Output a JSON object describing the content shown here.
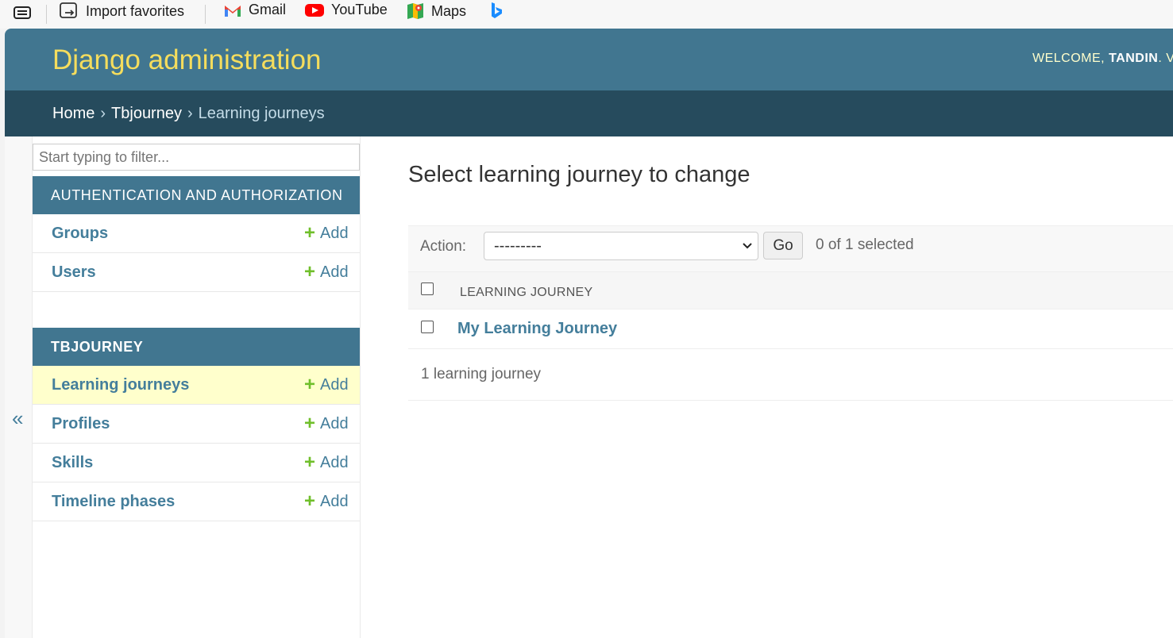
{
  "favorites_bar": {
    "items": [
      {
        "label": "",
        "icon": "tab-actions-icon"
      },
      {
        "label": "Import favorites",
        "icon": "import-favorites-icon"
      },
      {
        "label": "Gmail",
        "icon": "gmail-icon"
      },
      {
        "label": "YouTube",
        "icon": "youtube-icon"
      },
      {
        "label": "Maps",
        "icon": "maps-icon"
      },
      {
        "label": "",
        "icon": "bing-icon"
      }
    ]
  },
  "header": {
    "brand": "Django administration",
    "welcome": "WELCOME,",
    "username": "TANDIN",
    "after_user": ".",
    "view_site_partial": "VI"
  },
  "breadcrumbs": {
    "home": "Home",
    "app": "Tbjourney",
    "current": "Learning journeys",
    "separator": "›"
  },
  "sidebar": {
    "filter_placeholder": "Start typing to filter...",
    "collapse_label": "«",
    "add_label": "Add",
    "modules": [
      {
        "caption": "AUTHENTICATION AND AUTHORIZATION",
        "models": [
          {
            "name": "Groups"
          },
          {
            "name": "Users"
          }
        ]
      },
      {
        "caption": "TBJOURNEY",
        "models": [
          {
            "name": "Learning journeys",
            "current": true
          },
          {
            "name": "Profiles"
          },
          {
            "name": "Skills"
          },
          {
            "name": "Timeline phases"
          }
        ]
      }
    ]
  },
  "content": {
    "title": "Select learning journey to change",
    "action_label": "Action:",
    "action_selected": "---------",
    "go_label": "Go",
    "selected_count": "0 of 1 selected",
    "column_header": "LEARNING JOURNEY",
    "rows": [
      {
        "title": "My Learning Journey"
      }
    ],
    "result_count": "1 learning journey"
  },
  "colors": {
    "header_bg": "#417690",
    "breadcrumbs_bg": "#264b5d",
    "brand_text": "#f5dd5d",
    "link": "#447e9b",
    "add_plus": "#70bf2b",
    "current_row_bg": "#ffffcc"
  }
}
